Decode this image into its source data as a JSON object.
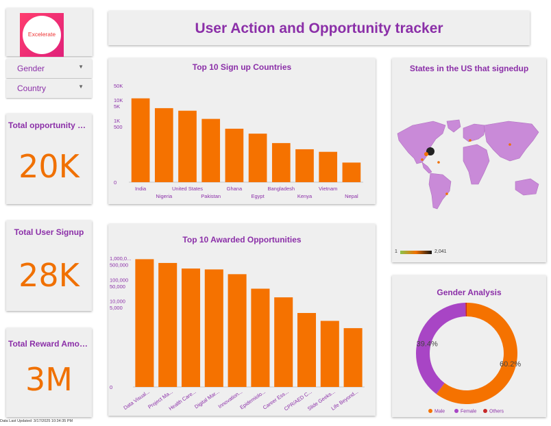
{
  "page": {
    "title": "User Action and Opportunity tracker",
    "logo_text": "Excelerate",
    "footer": "Data Last Updated: 3/17/2025 10:34:35 PM"
  },
  "filters": {
    "gender_label": "Gender",
    "country_label": "Country"
  },
  "kpis": {
    "opportunity": {
      "title": "Total opportunity si...",
      "value": "20K"
    },
    "signup": {
      "title": "Total User Signup",
      "value": "28K"
    },
    "reward": {
      "title": "Total Reward Amount",
      "value": "3M"
    }
  },
  "map": {
    "title": "States in the US that signedup",
    "legend_min": "1",
    "legend_max": "2,041"
  },
  "colors": {
    "accent_purple": "#8b2fa8",
    "bar_orange": "#f57200",
    "female_purple": "#a845c5",
    "others_red": "#c62828",
    "map_fill": "#c98ad8"
  },
  "chart_data": [
    {
      "type": "bar",
      "title": "Top 10 Sign up Countries",
      "scale": "log",
      "categories": [
        "India",
        "Nigeria",
        "United States",
        "Pakistan",
        "Ghana",
        "Egypt",
        "Bangladesh",
        "Kenya",
        "Vietnam",
        "Nepal"
      ],
      "values": [
        12000,
        4000,
        3000,
        1200,
        400,
        230,
        80,
        40,
        30,
        9
      ],
      "yticks": [
        "50K",
        "10K",
        "5K",
        "1K",
        "500",
        "0"
      ],
      "ytick_values": [
        50000,
        10000,
        5000,
        1000,
        500,
        1
      ]
    },
    {
      "type": "bar",
      "title": "Top 10 Awarded Opportunities",
      "scale": "log",
      "categories": [
        "Data Visual...",
        "Project Ma...",
        "Health Care...",
        "Digital Mar...",
        "Innovation...",
        "Epidemiolo...",
        "Career Ess...",
        "CPR/AED C...",
        "Slide Geeks...",
        "Life Beyond..."
      ],
      "values": [
        900000,
        600000,
        330000,
        300000,
        180000,
        38000,
        15000,
        2800,
        1200,
        550
      ],
      "yticks": [
        "1,000,0...",
        "500,000",
        "100,000",
        "50,000",
        "10,000",
        "5,000",
        "0"
      ],
      "ytick_values": [
        1000000,
        500000,
        100000,
        50000,
        10000,
        5000,
        1
      ]
    },
    {
      "type": "pie",
      "title": "Gender Analysis",
      "labels": [
        "Male",
        "Female",
        "Others"
      ],
      "values": [
        60.2,
        39.4,
        0.4
      ],
      "slice_labels": [
        "60.2%",
        "39.4%",
        ""
      ],
      "colors": [
        "#f57200",
        "#a845c5",
        "#c62828"
      ]
    }
  ]
}
